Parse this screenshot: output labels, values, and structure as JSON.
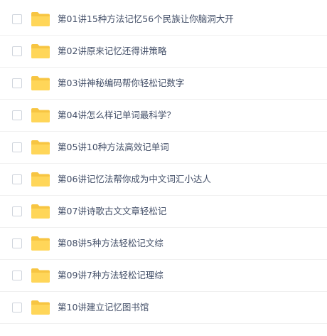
{
  "files": [
    {
      "name": "第01讲15种方法记忆56个民族让你脑洞大开",
      "icon": "folder-icon"
    },
    {
      "name": "第02讲原来记忆还得讲策略",
      "icon": "folder-icon"
    },
    {
      "name": "第03讲神秘编码帮你轻松记数字",
      "icon": "folder-icon"
    },
    {
      "name": "第04讲怎么样记单词最科学？",
      "icon": "folder-icon"
    },
    {
      "name": "第05讲10种方法高效记单词",
      "icon": "folder-icon"
    },
    {
      "name": "第06讲记忆法帮你成为中文词汇小达人",
      "icon": "folder-icon"
    },
    {
      "name": "第07讲诗歌古文文章轻松记",
      "icon": "folder-icon"
    },
    {
      "name": "第08讲5种方法轻松记文综",
      "icon": "folder-icon"
    },
    {
      "name": "第09讲7种方法轻松记理综",
      "icon": "folder-icon"
    },
    {
      "name": "第10讲建立记忆图书馆",
      "icon": "folder-icon"
    }
  ],
  "colors": {
    "folder_back": "#f7c542",
    "folder_front": "#ffd659",
    "text": "#424e67",
    "divider": "#f0f0f0",
    "checkbox_border": "#cfd4dc"
  }
}
